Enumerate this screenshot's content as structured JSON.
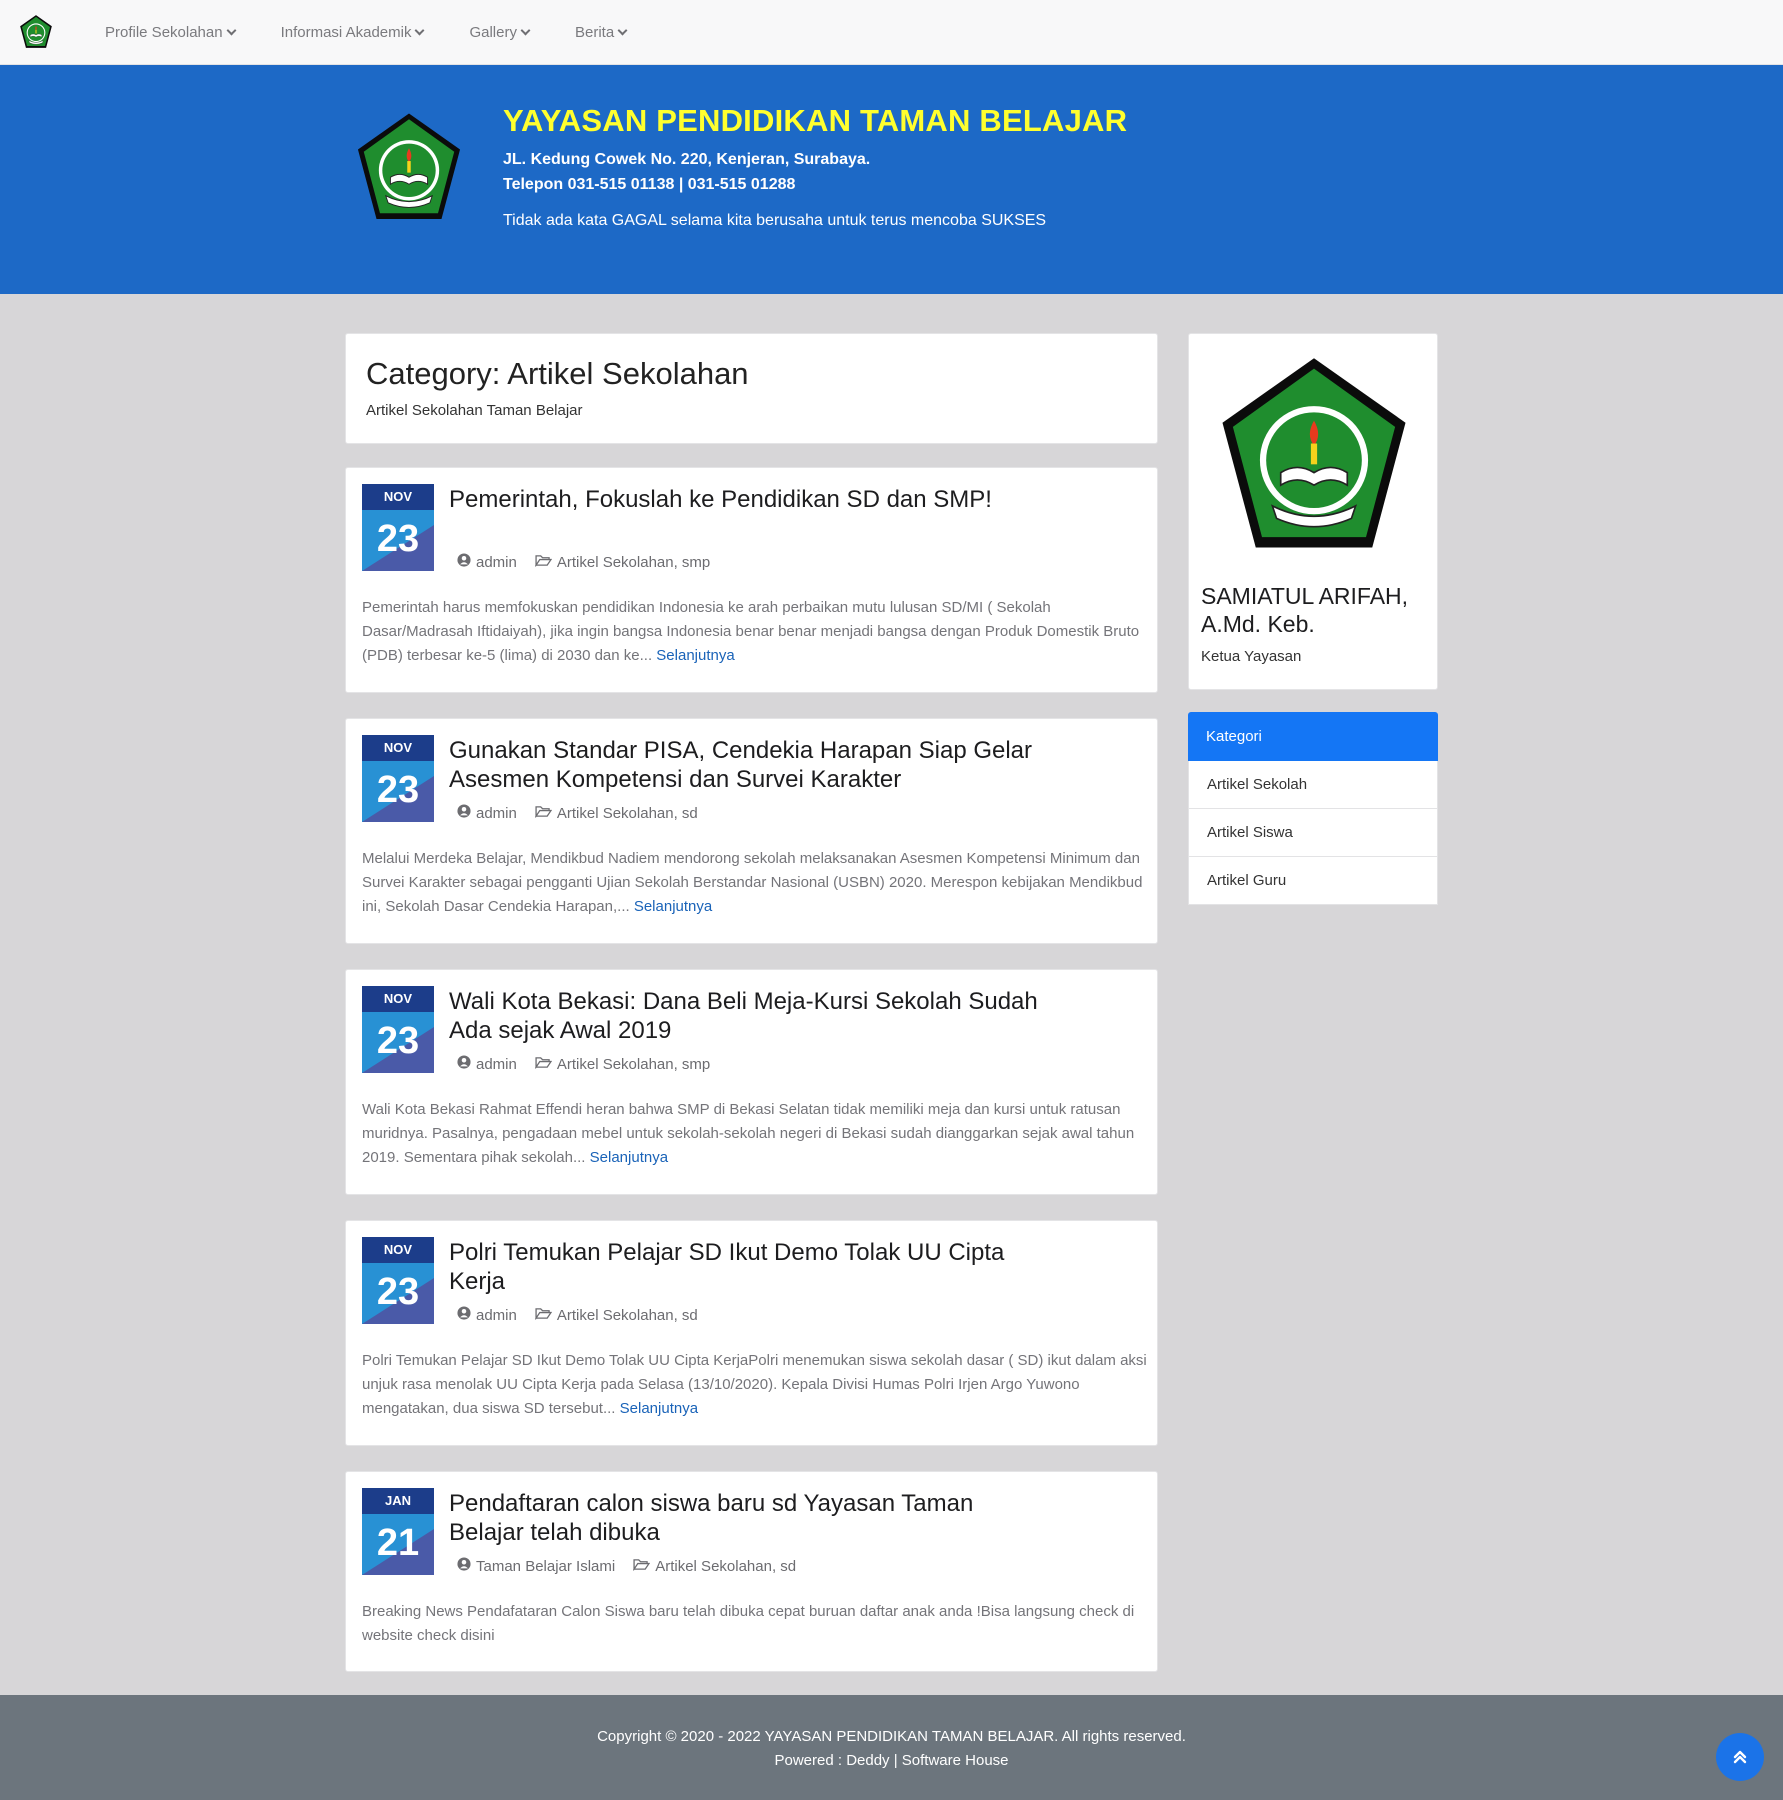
{
  "navbar": {
    "items": [
      {
        "label": "Profile Sekolahan"
      },
      {
        "label": "Informasi Akademik"
      },
      {
        "label": "Gallery"
      },
      {
        "label": "Berita"
      }
    ]
  },
  "hero": {
    "title": "YAYASAN PENDIDIKAN TAMAN BELAJAR",
    "address": "JL. Kedung Cowek No. 220, Kenjeran, Surabaya.",
    "phone": "Telepon 031-515 01138 | 031-515 01288",
    "motto": "Tidak ada kata GAGAL selama kita berusaha untuk terus mencoba SUKSES"
  },
  "category": {
    "title": "Category: Artikel Sekolahan",
    "description": "Artikel Sekolahan Taman Belajar"
  },
  "posts": [
    {
      "month": "NOV",
      "day": "23",
      "title": "Pemerintah, Fokuslah ke Pendidikan SD dan SMP!",
      "author": "admin",
      "categories": "Artikel Sekolahan, smp",
      "excerpt": "Pemerintah harus memfokuskan pendidikan Indonesia ke arah perbaikan mutu lulusan SD/MI ( Sekolah Dasar/Madrasah Iftidaiyah), jika ingin bangsa Indonesia benar benar menjadi bangsa dengan Produk Domestik Bruto (PDB) terbesar ke-5 (lima) di 2030 dan ke...",
      "more": "Selanjutnya"
    },
    {
      "month": "NOV",
      "day": "23",
      "title": "Gunakan Standar PISA, Cendekia Harapan Siap Gelar Asesmen Kompetensi dan Survei Karakter",
      "author": "admin",
      "categories": "Artikel Sekolahan, sd",
      "excerpt": "Melalui Merdeka Belajar, Mendikbud Nadiem mendorong sekolah melaksanakan Asesmen Kompetensi Minimum dan Survei Karakter sebagai pengganti Ujian Sekolah Berstandar Nasional (USBN) 2020. Merespon kebijakan Mendikbud ini, Sekolah Dasar Cendekia Harapan,...",
      "more": "Selanjutnya"
    },
    {
      "month": "NOV",
      "day": "23",
      "title": "Wali Kota Bekasi: Dana Beli Meja-Kursi Sekolah Sudah Ada sejak Awal 2019",
      "author": "admin",
      "categories": "Artikel Sekolahan, smp",
      "excerpt": "Wali Kota Bekasi Rahmat Effendi heran bahwa SMP di Bekasi Selatan tidak memiliki meja dan kursi untuk ratusan muridnya. Pasalnya, pengadaan mebel untuk sekolah-sekolah negeri di Bekasi sudah dianggarkan sejak awal tahun 2019. Sementara pihak sekolah...",
      "more": "Selanjutnya"
    },
    {
      "month": "NOV",
      "day": "23",
      "title": "Polri Temukan Pelajar SD Ikut Demo Tolak UU Cipta Kerja",
      "author": "admin",
      "categories": "Artikel Sekolahan, sd",
      "excerpt": "Polri Temukan Pelajar SD Ikut Demo Tolak UU Cipta KerjaPolri menemukan siswa sekolah dasar ( SD) ikut dalam aksi unjuk rasa menolak UU Cipta Kerja pada Selasa (13/10/2020). Kepala Divisi Humas Polri Irjen Argo Yuwono mengatakan, dua siswa SD tersebut...",
      "more": "Selanjutnya"
    },
    {
      "month": "JAN",
      "day": "21",
      "title": "Pendaftaran calon siswa baru sd Yayasan Taman Belajar telah dibuka",
      "author": "Taman Belajar Islami",
      "categories": "Artikel Sekolahan, sd",
      "excerpt": "Breaking News Pendafataran Calon Siswa baru telah dibuka cepat buruan daftar anak anda !Bisa langsung check di website check disini",
      "more": ""
    }
  ],
  "profile": {
    "name": "SAMIATUL ARIFAH, A.Md. Keb.",
    "role": "Ketua Yayasan"
  },
  "kategori": {
    "title": "Kategori",
    "items": [
      "Artikel Sekolah",
      "Artikel Siswa",
      "Artikel Guru"
    ]
  },
  "footer": {
    "copyright": "Copyright © 2020 - 2022 YAYASAN PENDIDIKAN TAMAN BELAJAR. All rights reserved.",
    "powered": "Powered : Deddy | Software House"
  },
  "colors": {
    "hero_bg": "#1d69c6",
    "hero_title": "#ffff2e",
    "accent": "#1476f5",
    "footer_bg": "#6c757d",
    "badge_month": "#1c3d8a",
    "badge_day": "#2891d4"
  }
}
